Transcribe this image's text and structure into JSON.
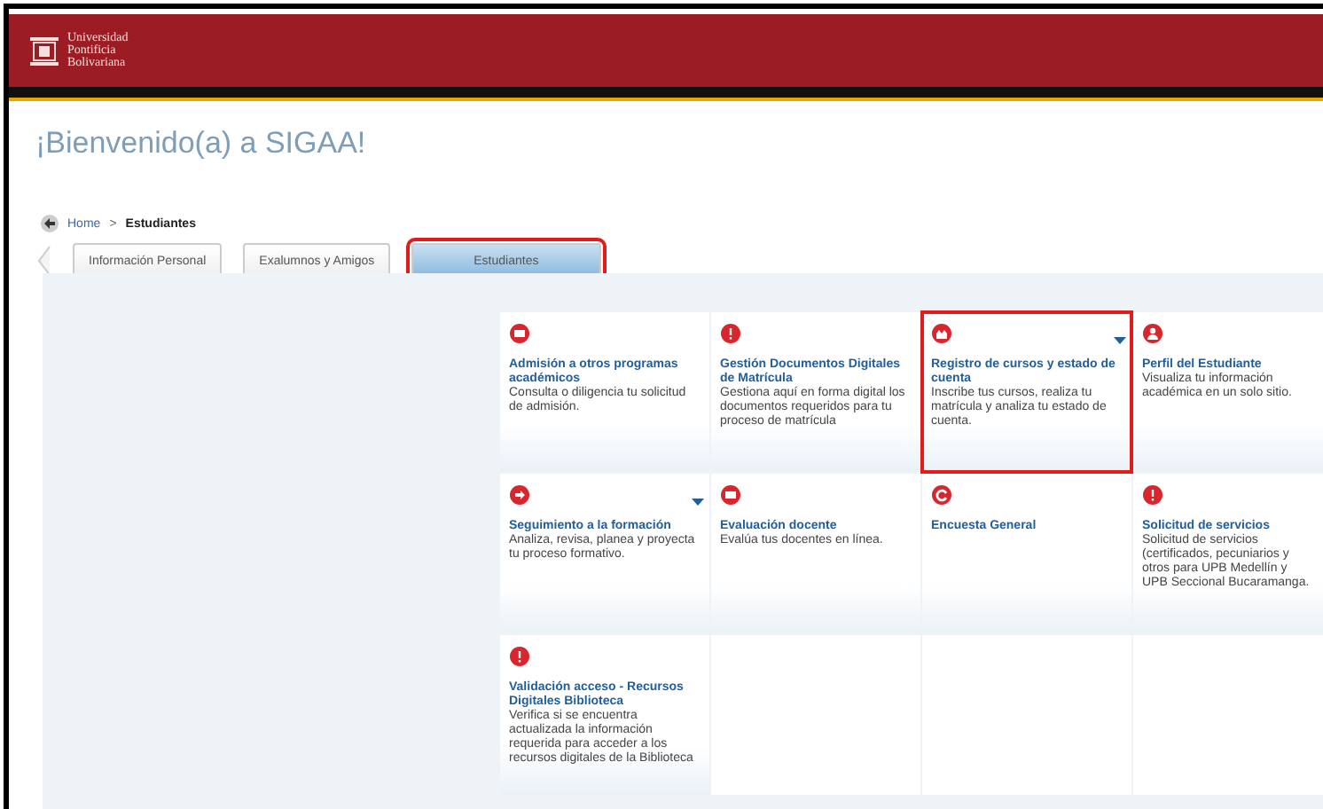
{
  "header": {
    "logo_text": [
      "Universidad",
      "Pontificia",
      "Bolivariana"
    ]
  },
  "title": "¡Bienvenido(a) a SIGAA!",
  "breadcrumb": [
    {
      "label": "Home",
      "link": true
    },
    {
      "label": "Estudiantes",
      "link": false
    }
  ],
  "breadcrumb_separator": ">",
  "tabs": [
    {
      "label": "Información Personal",
      "selected": false
    },
    {
      "label": "Exalumnos y Amigos",
      "selected": false
    },
    {
      "label": "Estudiantes",
      "selected": true
    }
  ],
  "tiles": [
    {
      "title": "Admisión a otros programas académicos",
      "description": "Consulta o diligencia tu solicitud de admisión.",
      "highlighted": false,
      "has_menu": false
    },
    {
      "title": "Gestión Documentos Digitales de Matrícula",
      "description": "Gestiona aquí en forma digital los documentos requeridos para tu proceso de matrícula",
      "highlighted": false,
      "has_menu": false
    },
    {
      "title": "Registro de cursos y estado de cuenta",
      "description": "Inscribe tus cursos, realiza tu matrícula y analiza tu estado de cuenta.",
      "highlighted": true,
      "has_menu": true
    },
    {
      "title": "Perfil del Estudiante",
      "description": "Visualiza tu información académica en un solo sitio.",
      "highlighted": false,
      "has_menu": false
    },
    {
      "title": "Seguimiento a la formación",
      "description": "Analiza, revisa, planea y proyecta tu proceso formativo.",
      "highlighted": false,
      "has_menu": true
    },
    {
      "title": "Evaluación docente",
      "description": "Evalúa tus docentes en línea.",
      "highlighted": false,
      "has_menu": false
    },
    {
      "title": "Encuesta General",
      "highlighted": false,
      "has_menu": false
    },
    {
      "title": "Solicitud de servicios",
      "description": "Solicitud de servicios (certificados, pecuniarios y otros para UPB Medellín y UPB Seccional Bucaramanga.",
      "highlighted": false,
      "has_menu": false
    },
    {
      "title": "Validación acceso - Recursos Digitales Biblioteca",
      "description": "Verifica si se encuentra actualizada la información requerida para acceder a los recursos digitales de la Biblioteca",
      "highlighted": false,
      "has_menu": false
    }
  ]
}
